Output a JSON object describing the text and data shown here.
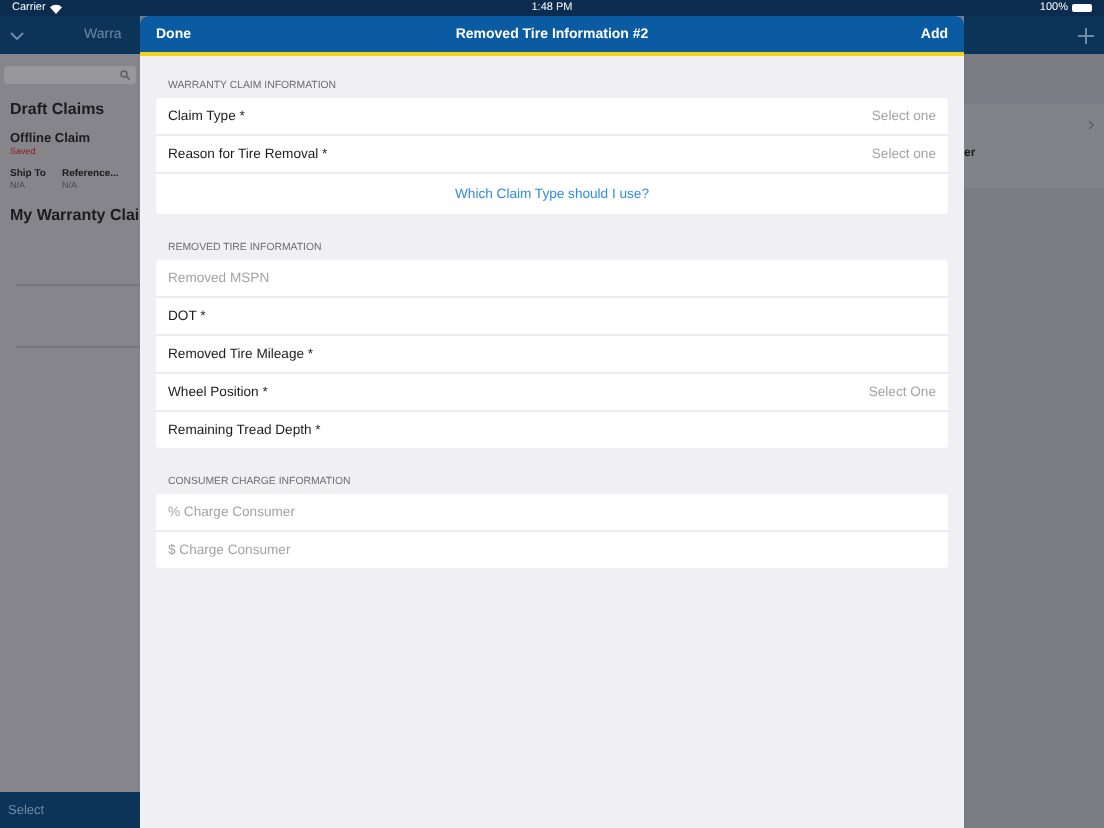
{
  "status_bar": {
    "carrier": "Carrier",
    "time": "1:48 PM",
    "battery": "100%"
  },
  "background": {
    "title": "Warra",
    "draft_heading": "Draft Claims",
    "claim": {
      "title": "Offline Claim",
      "status": "Saved",
      "fields": [
        {
          "label": "Ship To",
          "value": "N/A"
        },
        {
          "label": "Reference...",
          "value": "N/A"
        }
      ]
    },
    "my_heading": "My Warranty Clai",
    "right_text": "er",
    "bottom_button": "Select"
  },
  "modal": {
    "title": "Removed Tire Information #2",
    "left_button": "Done",
    "right_button": "Add",
    "sections": [
      {
        "header": "WARRANTY CLAIM INFORMATION",
        "rows": [
          {
            "kind": "picker",
            "label": "Claim Type *",
            "value": "Select one"
          },
          {
            "kind": "picker",
            "label": "Reason for Tire Removal *",
            "value": "Select one"
          },
          {
            "kind": "link",
            "label": "Which Claim Type should I use?"
          }
        ]
      },
      {
        "header": "REMOVED TIRE INFORMATION",
        "rows": [
          {
            "kind": "input",
            "placeholder": "Removed MSPN"
          },
          {
            "kind": "input",
            "label": "DOT *"
          },
          {
            "kind": "input",
            "label": "Removed Tire Mileage *"
          },
          {
            "kind": "picker",
            "label": "Wheel Position *",
            "value": "Select One"
          },
          {
            "kind": "input",
            "label": "Remaining Tread Depth *"
          }
        ]
      },
      {
        "header": "CONSUMER CHARGE INFORMATION",
        "rows": [
          {
            "kind": "input",
            "placeholder": "% Charge Consumer"
          },
          {
            "kind": "input",
            "placeholder": "$ Charge Consumer"
          }
        ]
      }
    ]
  }
}
